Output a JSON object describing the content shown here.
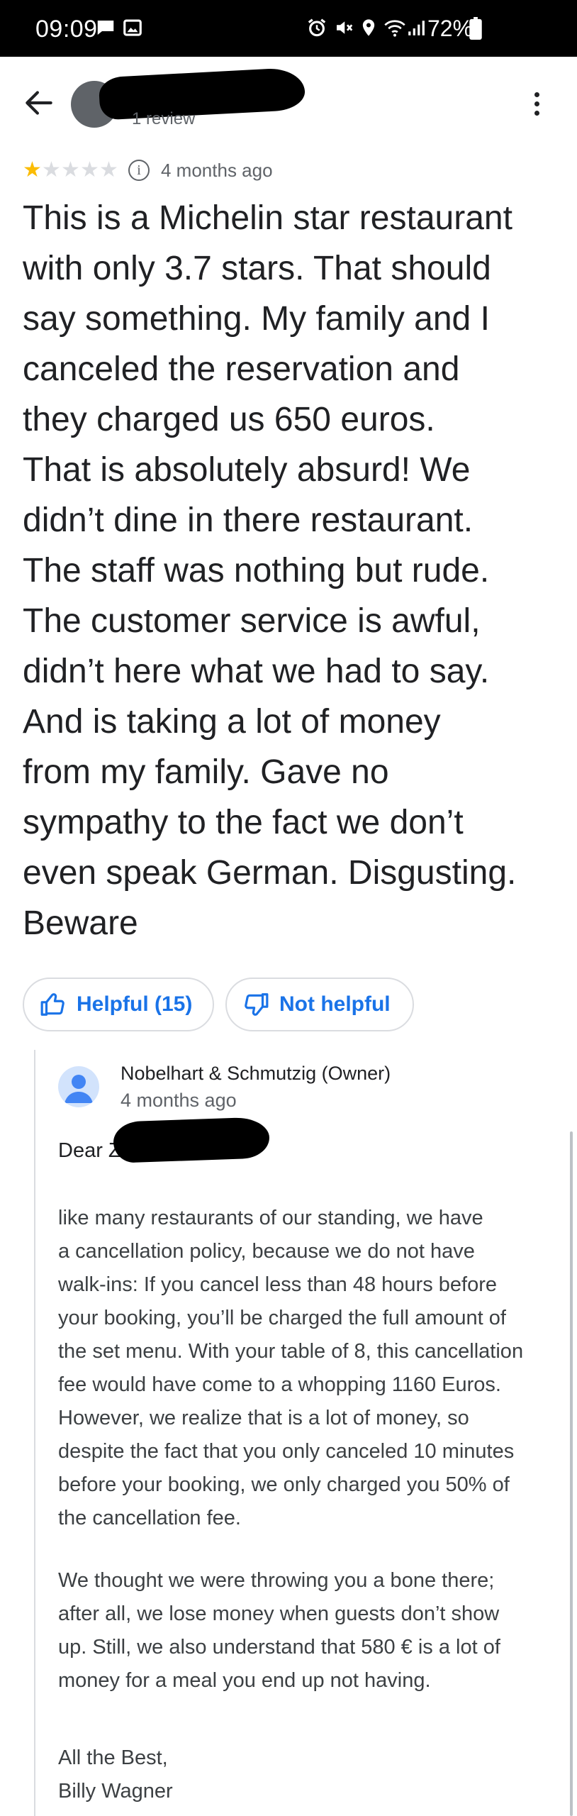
{
  "status_bar": {
    "time": "09:09",
    "battery": "72%",
    "icons": [
      "chat-bubble-icon",
      "gallery-icon",
      "alarm-icon",
      "mute-icon",
      "location-icon",
      "wifi-icon",
      "signal-icon",
      "battery-icon"
    ]
  },
  "header": {
    "review_count": "1 review",
    "icons": [
      "back-arrow-icon",
      "more-vert-icon"
    ]
  },
  "review": {
    "rating": 1,
    "max_rating": 5,
    "time": "4 months ago",
    "text": "This is a Michelin star restaurant\nwith only 3.7 stars. That should\nsay something.  My family and I\ncanceled the reservation and\nthey charged us 650 euros.\nThat is absolutely absurd! We\ndidn’t dine in there restaurant.\nThe staff was nothing but rude.\nThe customer service is awful,\ndidn’t here what we had to say.\nAnd is taking a lot of money\nfrom my family. Gave no\nsympathy to the fact we don’t\neven speak German. Disgusting.\nBeware"
  },
  "feedback": {
    "helpful_label": "Helpful (15)",
    "not_helpful_label": "Not helpful"
  },
  "owner_response": {
    "owner_name": "Nobelhart & Schmutzig (Owner)",
    "time": "4 months ago",
    "salutation": "Dear Z",
    "paragraph_1": "like many restaurants of our standing, we have\na cancellation policy, because we do not have\nwalk-ins: If you cancel less than 48 hours before\nyour booking, you’ll be charged the full amount of\nthe set menu. With your table of 8, this cancellation\nfee would have come to a whopping 1160 Euros.\nHowever, we realize that is a lot of money, so\ndespite the fact that you only canceled 10 minutes\nbefore your booking, we only charged you 50% of\nthe cancellation fee.",
    "paragraph_2": "We thought we were throwing you a bone there;\nafter all, we lose money when guests don’t show\nup. Still, we also understand that 580 € is a lot of\nmoney for a meal you end up not having.",
    "paragraph_3": "All the Best,\nBilly Wagner"
  },
  "colors": {
    "star_filled": "#fbbc04",
    "star_empty": "#dadce0",
    "accent_blue": "#1a73e8",
    "text_primary": "#202124",
    "text_secondary": "#5f6368"
  }
}
